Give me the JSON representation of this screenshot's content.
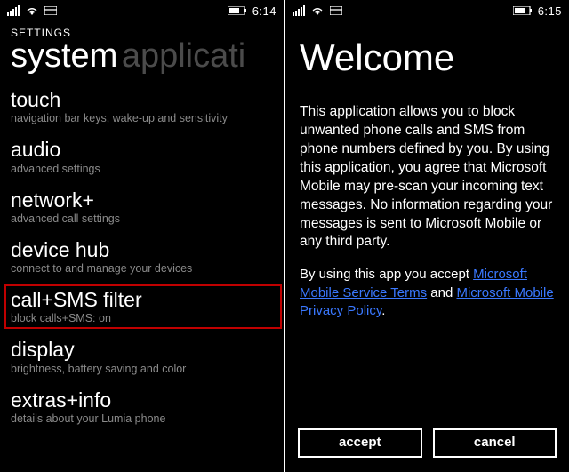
{
  "left": {
    "status": {
      "time": "6:14"
    },
    "breadcrumb": "SETTINGS",
    "pivot": {
      "active": "system",
      "inactive": "applicati"
    },
    "items": [
      {
        "title": "touch",
        "sub": "navigation bar keys, wake-up and sensitivity"
      },
      {
        "title": "audio",
        "sub": "advanced settings"
      },
      {
        "title": "network+",
        "sub": "advanced call settings"
      },
      {
        "title": "device hub",
        "sub": "connect to and manage your devices"
      },
      {
        "title": "call+SMS filter",
        "sub": "block calls+SMS: on"
      },
      {
        "title": "display",
        "sub": "brightness, battery saving and color"
      },
      {
        "title": "extras+info",
        "sub": "details about your Lumia phone"
      }
    ]
  },
  "right": {
    "status": {
      "time": "6:15"
    },
    "title": "Welcome",
    "body": "This application allows you to block unwanted phone calls and SMS from phone numbers defined by you. By using this application, you agree that Microsoft Mobile may pre-scan your incoming text messages. No information regarding your messages is sent to Microsoft Mobile or any third party.",
    "terms_prefix": "By using this app you accept ",
    "terms_link1": "Microsoft Mobile Service Terms",
    "terms_mid": " and ",
    "terms_link2": "Microsoft Mobile Privacy Policy",
    "terms_suffix": ".",
    "accept": "accept",
    "cancel": "cancel"
  }
}
